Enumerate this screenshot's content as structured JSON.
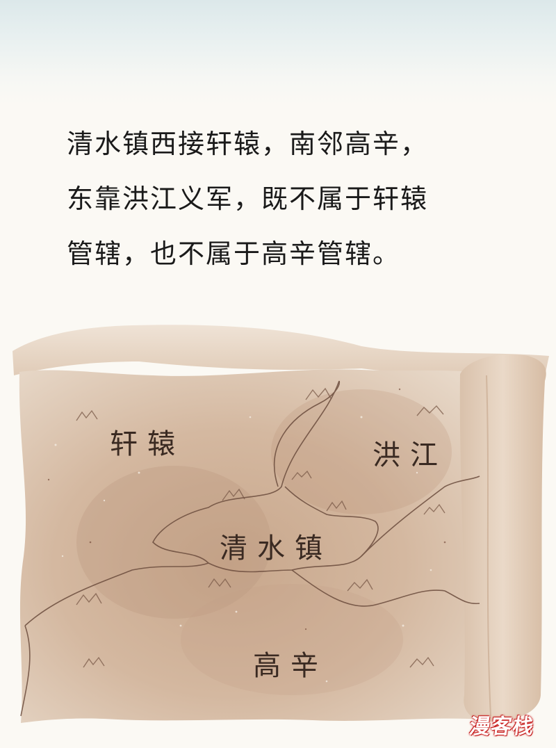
{
  "narration": {
    "line1": "清水镇西接轩辕，南邻高辛，",
    "line2": "东靠洪江义军，既不属于轩辕",
    "line3": "管辖，也不属于高辛管辖。"
  },
  "map": {
    "labels": {
      "xuanyuan": "轩辕",
      "hongjiang": "洪江",
      "qingshui": "清水镇",
      "gaoxin": "高辛"
    }
  },
  "watermark": "漫客栈",
  "colors": {
    "parchment": "#c9a98f",
    "parchment_light": "#e6d3c1",
    "ink": "#3a2a22",
    "text": "#1a1a1a"
  }
}
